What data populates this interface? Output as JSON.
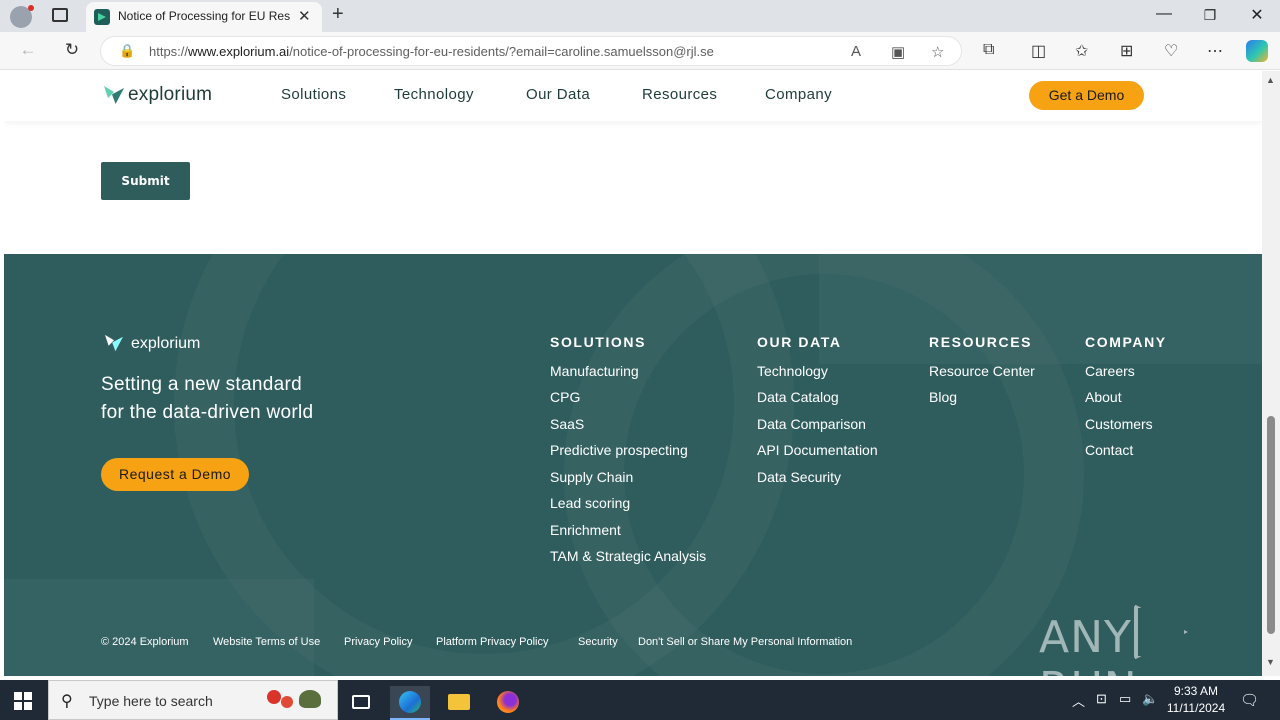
{
  "browser": {
    "tab_title": "Notice of Processing for EU Resid",
    "url_prefix": "https://",
    "url_domain": "www.explorium.ai",
    "url_path": "/notice-of-processing-for-eu-residents/?email=caroline.samuelsson@rjl.se"
  },
  "header": {
    "logo_text": "explorium",
    "nav": [
      "Solutions",
      "Technology",
      "Our Data",
      "Resources",
      "Company"
    ],
    "demo_label": "Get a Demo"
  },
  "form": {
    "submit_label": "Submit"
  },
  "footer": {
    "logo_text": "explorium",
    "tagline_line1": "Setting a new standard",
    "tagline_line2": "for the data-driven world",
    "request_demo_label": "Request a Demo",
    "columns": [
      {
        "heading": "SOLUTIONS",
        "items": [
          "Manufacturing",
          "CPG",
          "SaaS",
          "Predictive prospecting",
          "Supply Chain",
          "Lead scoring",
          "Enrichment",
          "TAM & Strategic Analysis"
        ]
      },
      {
        "heading": "OUR DATA",
        "items": [
          "Technology",
          "Data Catalog",
          "Data Comparison",
          "API Documentation",
          "Data Security"
        ]
      },
      {
        "heading": "RESOURCES",
        "items": [
          "Resource Center",
          "Blog"
        ]
      },
      {
        "heading": "COMPANY",
        "items": [
          "Careers",
          "About",
          "Customers",
          "Contact"
        ]
      }
    ],
    "legal": [
      "© 2024 Explorium",
      "Website Terms of Use",
      "Privacy Policy",
      "Platform Privacy Policy",
      "Security",
      "Don't Sell or Share My Personal Information"
    ],
    "watermark_left": "ANY",
    "watermark_right": "RUN"
  },
  "taskbar": {
    "search_placeholder": "Type here to search",
    "time": "9:33 AM",
    "date": "11/11/2024"
  },
  "colors": {
    "footer_bg": "#2f5d5d",
    "accent_orange": "#f7a213",
    "submit_bg": "#2f5d5c"
  }
}
